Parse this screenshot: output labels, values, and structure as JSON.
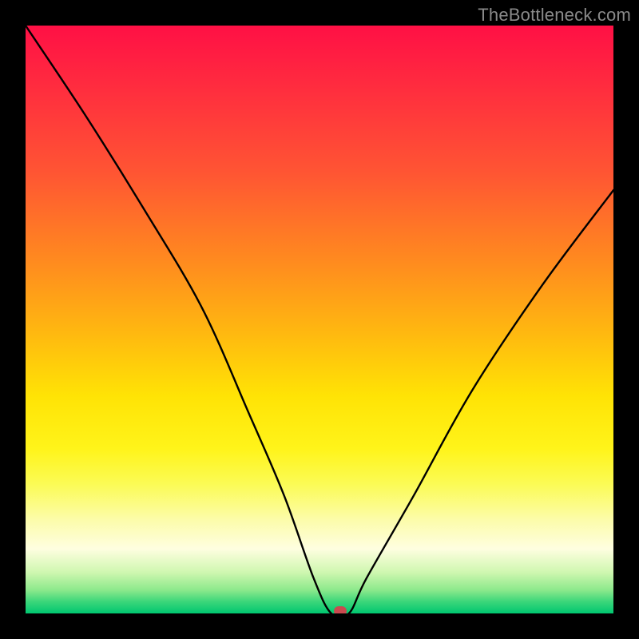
{
  "watermark": "TheBottleneck.com",
  "colors": {
    "frame": "#000000",
    "marker": "#c94a4f",
    "curve": "#000000"
  },
  "chart_data": {
    "type": "line",
    "title": "",
    "xlabel": "",
    "ylabel": "",
    "xlim": [
      0,
      100
    ],
    "ylim": [
      0,
      100
    ],
    "series": [
      {
        "name": "bottleneck-curve",
        "x": [
          0,
          10,
          20,
          30,
          38,
          44,
          49,
          52,
          55,
          58,
          66,
          76,
          88,
          100
        ],
        "y": [
          100,
          85,
          69,
          52,
          34,
          20,
          6,
          0,
          0,
          6,
          20,
          38,
          56,
          72
        ]
      }
    ],
    "marker": {
      "x": 53.5,
      "y": 0
    },
    "gradient_stops": [
      {
        "pos": 0,
        "color": "#ff1045"
      },
      {
        "pos": 50,
        "color": "#ffd000"
      },
      {
        "pos": 85,
        "color": "#fefee0"
      },
      {
        "pos": 100,
        "color": "#00c770"
      }
    ]
  }
}
